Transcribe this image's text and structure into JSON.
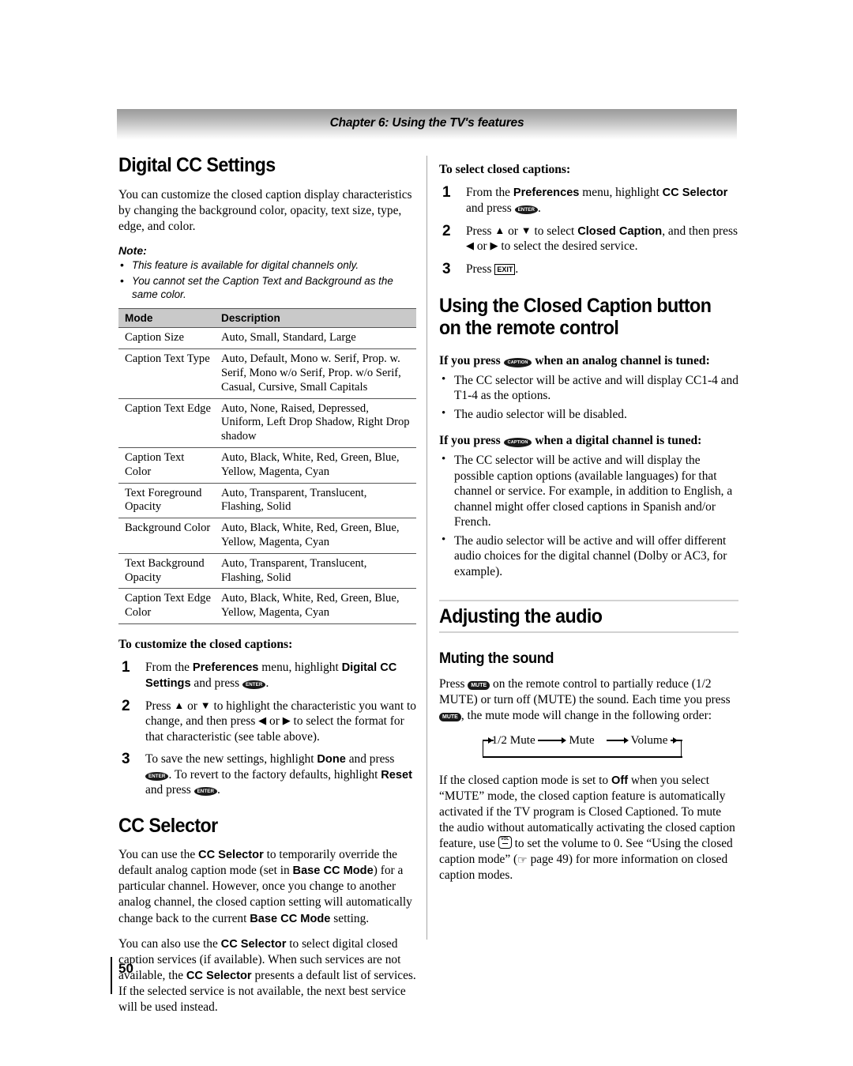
{
  "header": {
    "chapter_band": "Chapter 6: Using the TV's features"
  },
  "folio": {
    "page_number": "50"
  },
  "left_column": {
    "heading_digital_cc": "Digital CC Settings",
    "intro_paragraph": "You can customize the closed caption display characteristics by changing the background color, opacity, text size, type, edge, and color.",
    "note": {
      "title": "Note:",
      "items": [
        "This feature is available for digital channels only.",
        "You cannot set the Caption Text and Background as the same color."
      ]
    },
    "table": {
      "columns": [
        "Mode",
        "Description"
      ],
      "rows": [
        {
          "mode": "Caption Size",
          "description": "Auto, Small, Standard, Large"
        },
        {
          "mode": "Caption Text Type",
          "description": "Auto, Default, Mono w. Serif, Prop. w. Serif, Mono w/o Serif, Prop. w/o Serif, Casual, Cursive, Small Capitals"
        },
        {
          "mode": "Caption Text Edge",
          "description": "Auto, None, Raised, Depressed, Uniform, Left Drop Shadow, Right Drop shadow"
        },
        {
          "mode": "Caption Text Color",
          "description": "Auto, Black, White, Red, Green, Blue, Yellow, Magenta, Cyan"
        },
        {
          "mode": "Text Foreground Opacity",
          "description": "Auto, Transparent, Translucent, Flashing, Solid"
        },
        {
          "mode": "Background Color",
          "description": "Auto, Black, White, Red, Green, Blue, Yellow, Magenta, Cyan"
        },
        {
          "mode": "Text Background Opacity",
          "description": "Auto, Transparent, Translucent, Flashing, Solid"
        },
        {
          "mode": "Caption Text Edge Color",
          "description": "Auto, Black, White, Red, Green, Blue, Yellow, Magenta, Cyan"
        }
      ]
    },
    "customize_procedure": {
      "title": "To customize the closed captions:",
      "step1": {
        "t1": "From the ",
        "b1": "Preferences",
        "t2": " menu, highlight ",
        "b2": "Digital CC Settings",
        "t3": " and press ",
        "key": "ENTER",
        "t4": "."
      },
      "step2": {
        "t1": "Press ",
        "a1": "▲",
        "t2": " or ",
        "a2": "▼",
        "t3": " to highlight the characteristic you want to change, and then press ",
        "a3": "◀",
        "t4": " or ",
        "a4": "▶",
        "t5": " to select the format for that characteristic (see table above)."
      },
      "step3": {
        "t1": "To save the new settings, highlight ",
        "b1": "Done",
        "t2": " and press ",
        "key1": "ENTER",
        "t3": ". To revert to the factory defaults, highlight ",
        "b2": "Reset",
        "t4": " and press ",
        "key2": "ENTER",
        "t5": "."
      }
    },
    "heading_cc_selector": "CC Selector",
    "cc_selector_p1": {
      "t1": "You can use the ",
      "b1": "CC Selector",
      "t2": " to temporarily override the default analog caption mode (set in ",
      "b2": "Base CC Mode",
      "t3": ") for a particular channel. However, once you change to another analog channel, the closed caption setting will automatically change back to the current ",
      "b3": "Base CC Mode",
      "t4": " setting."
    },
    "cc_selector_p2": {
      "t1": "You can also use the ",
      "b1": "CC Selector",
      "t2": " to select digital closed caption services (if available). When such services are not available, the ",
      "b2": "CC Selector",
      "t3": " presents a default list of services. If the selected service is not available, the next best service will be used instead."
    }
  },
  "right_column": {
    "select_procedure": {
      "title": "To select closed captions:",
      "step1": {
        "t1": "From the ",
        "b1": "Preferences",
        "t2": " menu, highlight ",
        "b2": "CC Selector",
        "t3": " and press ",
        "key": "ENTER",
        "t4": "."
      },
      "step2": {
        "t1": "Press ",
        "a1": "▲",
        "t2": " or ",
        "a2": "▼",
        "t3": " to select ",
        "b1": "Closed Caption",
        "t4": ", and then press ",
        "a3": "◀",
        "t5": " or ",
        "a4": "▶",
        "t6": " to select the desired service."
      },
      "step3": {
        "t1": "Press ",
        "key": "EXIT",
        "t2": "."
      }
    },
    "heading_cc_button": "Using the Closed Caption button on the remote control",
    "analog_section": {
      "lead_t1": "If you press ",
      "lead_key": "CAPTION",
      "lead_t2": " when an analog channel is tuned:",
      "bullets": [
        "The CC selector will be active and will display CC1-4 and T1-4 as the options.",
        "The audio selector will be disabled."
      ]
    },
    "digital_section": {
      "lead_t1": "If you press ",
      "lead_key": "CAPTION",
      "lead_t2": " when a digital channel is tuned:",
      "bullets": [
        "The CC selector will be active and will display the possible caption options (available languages) for that channel or service. For example, in addition to English, a channel might offer closed captions in Spanish and/or French.",
        "The audio selector will be active and will offer different audio choices for the digital channel (Dolby or AC3, for example)."
      ]
    },
    "heading_adjusting_audio": "Adjusting the audio",
    "heading_muting": "Muting the sound",
    "muting_paragraph": {
      "t1": "Press ",
      "key1": "MUTE",
      "t2": " on the remote control to partially reduce (1/2 MUTE) or turn off (MUTE) the sound. Each time you press ",
      "key2": "MUTE",
      "t3": ", the mute mode will change in the following order:"
    },
    "mute_cycle": {
      "steps": [
        "1/2 Mute",
        "Mute",
        "Volume"
      ]
    },
    "muting_paragraph2": {
      "t1": "If the closed caption mode is set to ",
      "b1": "Off",
      "t2": " when you select “MUTE” mode, the closed caption feature is automatically activated if the TV program is Closed Captioned. To mute the audio without automatically activating the closed caption feature, use ",
      "key_vol": "VOL",
      "t3": " to set the volume to 0. See “Using the closed caption mode” (",
      "hand": "☞",
      "t4": " page 49) for more information on closed caption modes."
    }
  },
  "colors": {
    "band_top": "#9b9b9b",
    "table_header_bg": "#c9c9c9",
    "rule": "#555555",
    "divider": "#a8a8a8"
  }
}
